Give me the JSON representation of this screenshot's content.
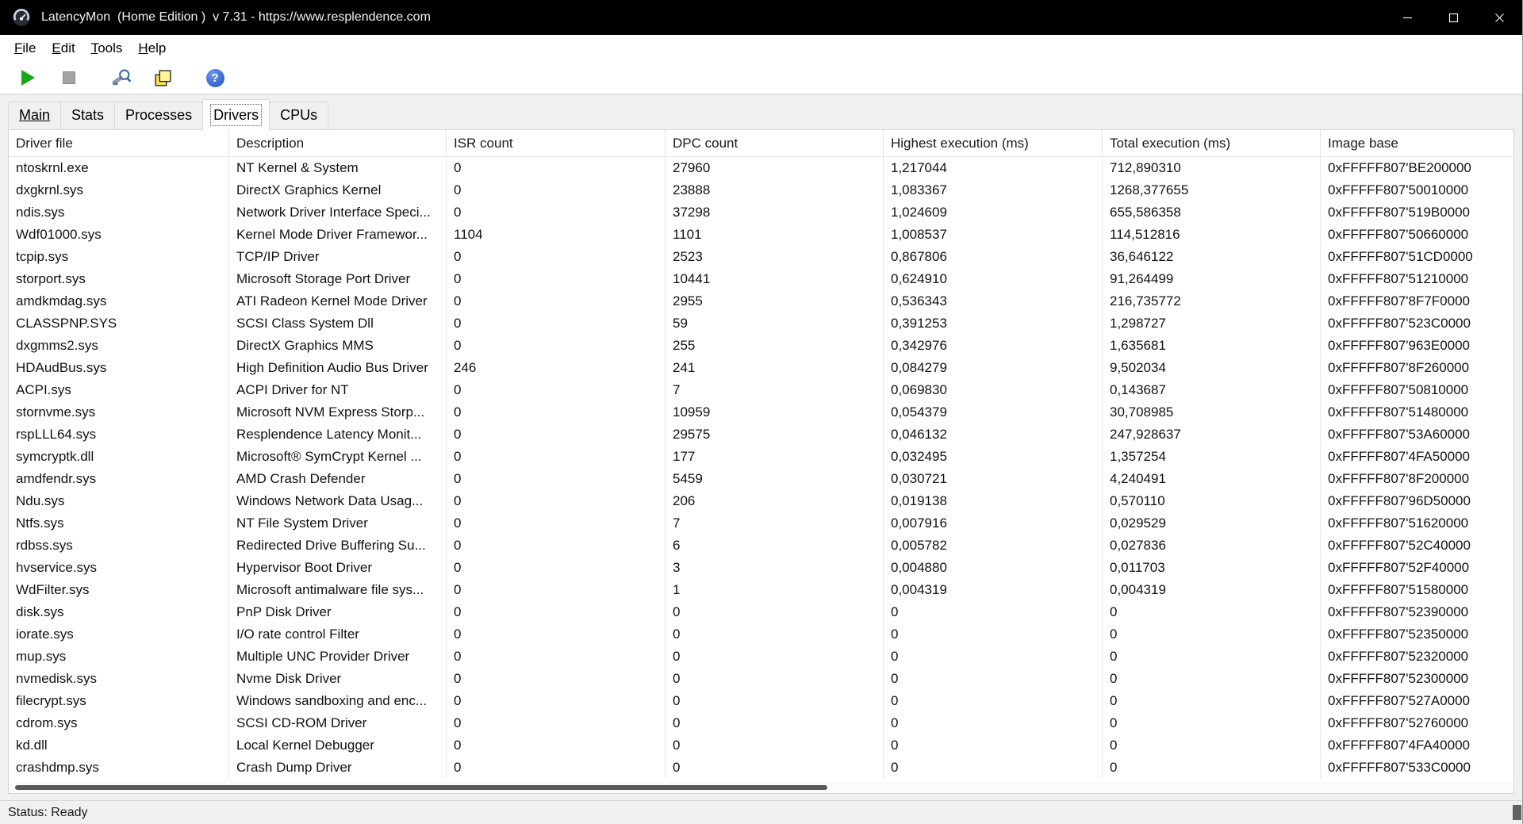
{
  "colors": {
    "titlebar_bg": "#000000",
    "play_green": "#17a817",
    "help_blue": "#2f63d8",
    "window_chrome": "#f0f0f0"
  },
  "titlebar": {
    "title": "LatencyMon  (Home Edition )  v 7.31 - https://www.resplendence.com"
  },
  "menubar": {
    "items": [
      "File",
      "Edit",
      "Tools",
      "Help"
    ]
  },
  "toolbar": {
    "help_glyph": "?",
    "buttons": [
      "start-monitor",
      "stop-monitor",
      "tools",
      "copy-report",
      "help"
    ]
  },
  "tabs": {
    "items": [
      {
        "label": "Main",
        "active": false,
        "underlined": true
      },
      {
        "label": "Stats",
        "active": false,
        "underlined": false
      },
      {
        "label": "Processes",
        "active": false,
        "underlined": false
      },
      {
        "label": "Drivers",
        "active": true,
        "underlined": false
      },
      {
        "label": "CPUs",
        "active": false,
        "underlined": false
      }
    ]
  },
  "table": {
    "columns": [
      "Driver file",
      "Description",
      "ISR count",
      "DPC count",
      "Highest execution (ms)",
      "Total execution (ms)",
      "Image base"
    ],
    "rows": [
      [
        "ntoskrnl.exe",
        "NT Kernel & System",
        "0",
        "27960",
        "1,217044",
        "712,890310",
        "0xFFFFF807'BE200000"
      ],
      [
        "dxgkrnl.sys",
        "DirectX Graphics Kernel",
        "0",
        "23888",
        "1,083367",
        "1268,377655",
        "0xFFFFF807'50010000"
      ],
      [
        "ndis.sys",
        "Network Driver Interface Speci...",
        "0",
        "37298",
        "1,024609",
        "655,586358",
        "0xFFFFF807'519B0000"
      ],
      [
        "Wdf01000.sys",
        "Kernel Mode Driver Framewor...",
        "1104",
        "1101",
        "1,008537",
        "114,512816",
        "0xFFFFF807'50660000"
      ],
      [
        "tcpip.sys",
        "TCP/IP Driver",
        "0",
        "2523",
        "0,867806",
        "36,646122",
        "0xFFFFF807'51CD0000"
      ],
      [
        "storport.sys",
        "Microsoft Storage Port Driver",
        "0",
        "10441",
        "0,624910",
        "91,264499",
        "0xFFFFF807'51210000"
      ],
      [
        "amdkmdag.sys",
        "ATI Radeon Kernel Mode Driver",
        "0",
        "2955",
        "0,536343",
        "216,735772",
        "0xFFFFF807'8F7F0000"
      ],
      [
        "CLASSPNP.SYS",
        "SCSI Class System Dll",
        "0",
        "59",
        "0,391253",
        "1,298727",
        "0xFFFFF807'523C0000"
      ],
      [
        "dxgmms2.sys",
        "DirectX Graphics MMS",
        "0",
        "255",
        "0,342976",
        "1,635681",
        "0xFFFFF807'963E0000"
      ],
      [
        "HDAudBus.sys",
        "High Definition Audio Bus Driver",
        "246",
        "241",
        "0,084279",
        "9,502034",
        "0xFFFFF807'8F260000"
      ],
      [
        "ACPI.sys",
        "ACPI Driver for NT",
        "0",
        "7",
        "0,069830",
        "0,143687",
        "0xFFFFF807'50810000"
      ],
      [
        "stornvme.sys",
        "Microsoft NVM Express Storp...",
        "0",
        "10959",
        "0,054379",
        "30,708985",
        "0xFFFFF807'51480000"
      ],
      [
        "rspLLL64.sys",
        "Resplendence Latency Monit...",
        "0",
        "29575",
        "0,046132",
        "247,928637",
        "0xFFFFF807'53A60000"
      ],
      [
        "symcryptk.dll",
        "Microsoft® SymCrypt Kernel ...",
        "0",
        "177",
        "0,032495",
        "1,357254",
        "0xFFFFF807'4FA50000"
      ],
      [
        "amdfendr.sys",
        "AMD Crash Defender",
        "0",
        "5459",
        "0,030721",
        "4,240491",
        "0xFFFFF807'8F200000"
      ],
      [
        "Ndu.sys",
        "Windows Network Data Usag...",
        "0",
        "206",
        "0,019138",
        "0,570110",
        "0xFFFFF807'96D50000"
      ],
      [
        "Ntfs.sys",
        "NT File System Driver",
        "0",
        "7",
        "0,007916",
        "0,029529",
        "0xFFFFF807'51620000"
      ],
      [
        "rdbss.sys",
        "Redirected Drive Buffering Su...",
        "0",
        "6",
        "0,005782",
        "0,027836",
        "0xFFFFF807'52C40000"
      ],
      [
        "hvservice.sys",
        "Hypervisor Boot Driver",
        "0",
        "3",
        "0,004880",
        "0,011703",
        "0xFFFFF807'52F40000"
      ],
      [
        "WdFilter.sys",
        "Microsoft antimalware file sys...",
        "0",
        "1",
        "0,004319",
        "0,004319",
        "0xFFFFF807'51580000"
      ],
      [
        "disk.sys",
        "PnP Disk Driver",
        "0",
        "0",
        "0",
        "0",
        "0xFFFFF807'52390000"
      ],
      [
        "iorate.sys",
        "I/O rate control Filter",
        "0",
        "0",
        "0",
        "0",
        "0xFFFFF807'52350000"
      ],
      [
        "mup.sys",
        "Multiple UNC Provider Driver",
        "0",
        "0",
        "0",
        "0",
        "0xFFFFF807'52320000"
      ],
      [
        "nvmedisk.sys",
        "Nvme Disk Driver",
        "0",
        "0",
        "0",
        "0",
        "0xFFFFF807'52300000"
      ],
      [
        "filecrypt.sys",
        "Windows sandboxing and enc...",
        "0",
        "0",
        "0",
        "0",
        "0xFFFFF807'527A0000"
      ],
      [
        "cdrom.sys",
        "SCSI CD-ROM Driver",
        "0",
        "0",
        "0",
        "0",
        "0xFFFFF807'52760000"
      ],
      [
        "kd.dll",
        "Local Kernel Debugger",
        "0",
        "0",
        "0",
        "0",
        "0xFFFFF807'4FA40000"
      ],
      [
        "crashdmp.sys",
        "Crash Dump Driver",
        "0",
        "0",
        "0",
        "0",
        "0xFFFFF807'533C0000"
      ]
    ]
  },
  "statusbar": {
    "text": "Status: Ready"
  }
}
